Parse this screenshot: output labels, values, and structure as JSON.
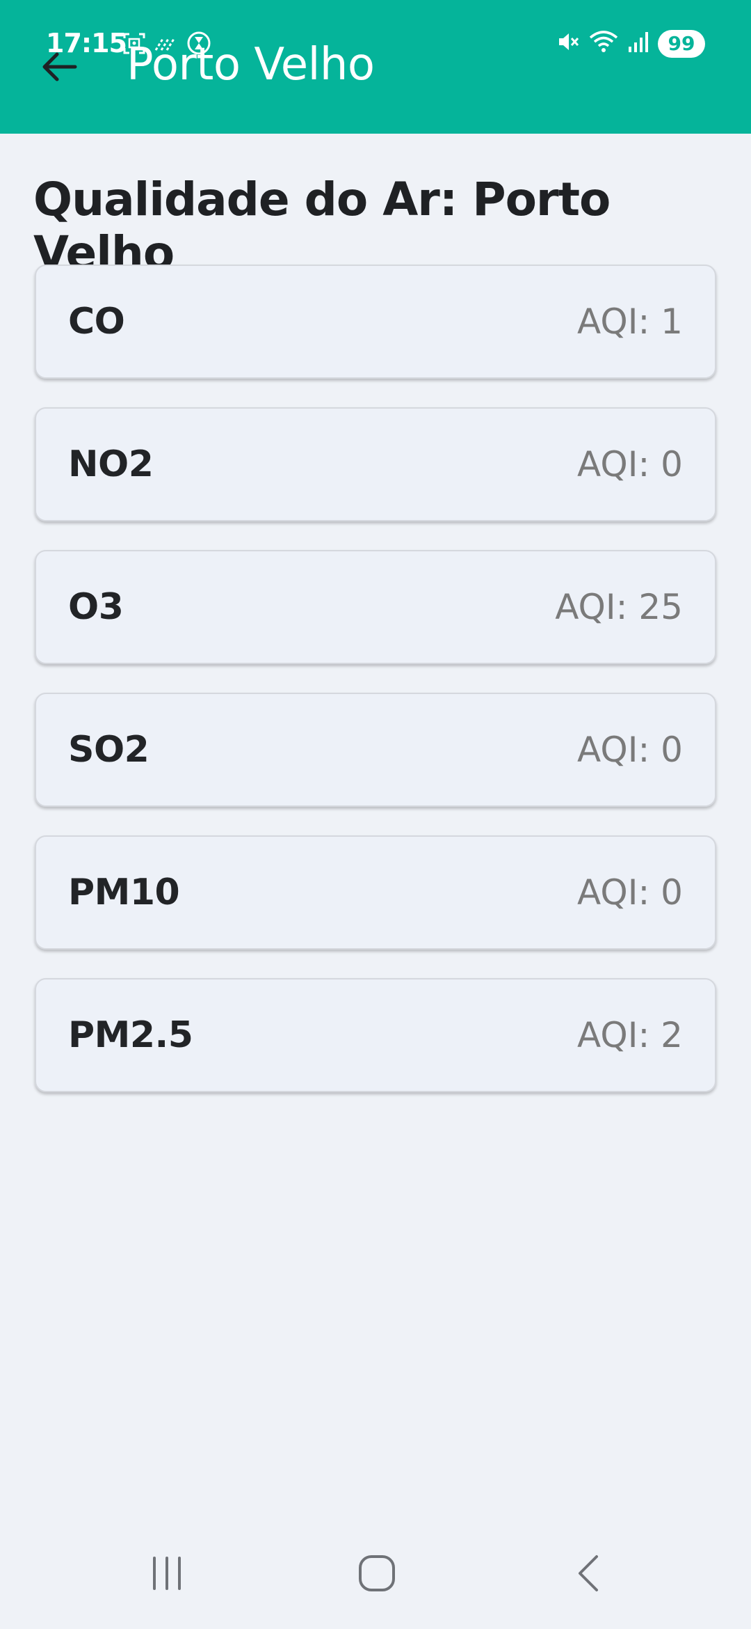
{
  "status_bar": {
    "time": "17:15",
    "battery": "99",
    "icons": [
      "screenshot-icon",
      "data-saver-icon",
      "timer-icon",
      "mute-icon",
      "wifi-icon",
      "signal-icon"
    ]
  },
  "appbar": {
    "title": "Porto Velho",
    "back_icon": "arrow-back-icon",
    "color": "#05b49a"
  },
  "main": {
    "title": "Qualidade do Ar: Porto Velho",
    "items": [
      {
        "name": "CO",
        "aqi": "AQI: 1"
      },
      {
        "name": "NO2",
        "aqi": "AQI: 0"
      },
      {
        "name": "O3",
        "aqi": "AQI: 25"
      },
      {
        "name": "SO2",
        "aqi": "AQI: 0"
      },
      {
        "name": "PM10",
        "aqi": "AQI: 0"
      },
      {
        "name": "PM2.5",
        "aqi": "AQI: 2"
      }
    ]
  },
  "navbar": {
    "buttons": [
      "recent-apps-icon",
      "home-icon",
      "back-nav-icon"
    ]
  }
}
